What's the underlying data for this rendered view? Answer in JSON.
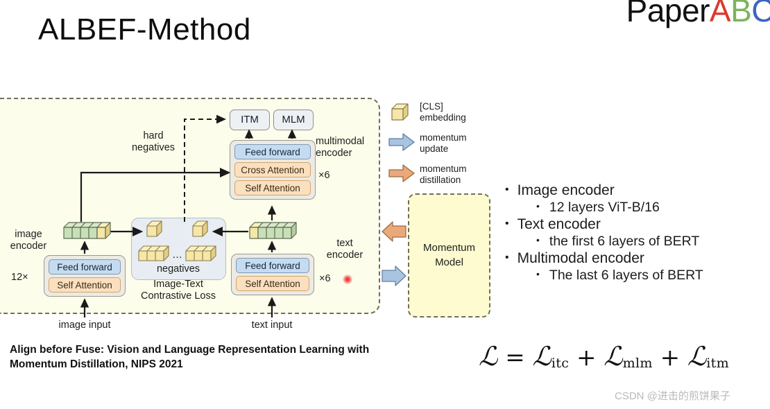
{
  "slide": {
    "title": "ALBEF-Method",
    "background": "#ffffff"
  },
  "logo": {
    "part_black": "Paper",
    "part_red": "A",
    "part_green": "B",
    "part_blue": "C",
    "colors": {
      "red": "#d93b2b",
      "green": "#7ab45c",
      "blue": "#3b64c4",
      "black": "#111111"
    }
  },
  "diagram": {
    "panel_fill": "#fdfdeb",
    "heads": {
      "itm": "ITM",
      "mlm": "MLM"
    },
    "labels": {
      "hard_negatives": "hard\nnegatives",
      "multimodal_encoder": "multimodal\nencoder",
      "multimodal_repeat": "×6",
      "image_encoder": "image\nencoder",
      "image_repeat": "12×",
      "negatives": "negatives",
      "itc_loss": "Image-Text\nContrastive Loss",
      "text_encoder": "text\nencoder",
      "text_repeat": "×6",
      "image_input": "image input",
      "text_input": "text input"
    },
    "blocks": {
      "feed_forward": "Feed forward",
      "self_attention": "Self Attention",
      "cross_attention": "Cross Attention"
    },
    "momentum_model": "Momentum\nModel",
    "block_colors": {
      "feed_forward": "#c5dcf0",
      "attention": "#fbe0bf",
      "stack_bg": "#eceae4",
      "itc_bg": "#e7edf2",
      "momentum_bg": "#fdfbcf",
      "cls_cube": "#f6e6a8",
      "token_cube": "#c9dfb8"
    },
    "laser_pointer_color": "#ff2a2a"
  },
  "legend": [
    {
      "icon": "cls-cube-icon",
      "label": "[CLS]\nembedding",
      "color": "#f6e6a8"
    },
    {
      "icon": "blue-arrow-icon",
      "label": "momentum\nupdate",
      "color": "#a8c4e0"
    },
    {
      "icon": "orange-arrow-icon",
      "label": "momentum\ndistillation",
      "color": "#eaa97a"
    }
  ],
  "bullets": [
    {
      "level": 1,
      "text": "Image encoder"
    },
    {
      "level": 2,
      "text": "12 layers ViT-B/16"
    },
    {
      "level": 1,
      "text": "Text encoder"
    },
    {
      "level": 2,
      "text": "the first 6 layers of BERT"
    },
    {
      "level": 1,
      "text": "Multimodal encoder"
    },
    {
      "level": 2,
      "text": "The last 6 layers of BERT"
    }
  ],
  "caption": "Align before Fuse: Vision and Language Representation Learning with Momentum Distillation, NIPS 2021",
  "formula": {
    "plain": "L = L_itc + L_mlm + L_itm",
    "lhs": "ℒ",
    "eq": "=",
    "term1_base": "ℒ",
    "term1_sub": "itc",
    "plus1": "+",
    "term2_base": "ℒ",
    "term2_sub": "mlm",
    "plus2": "+",
    "term3_base": "ℒ",
    "term3_sub": "itm"
  },
  "watermark": "CSDN @进击的煎饼果子"
}
